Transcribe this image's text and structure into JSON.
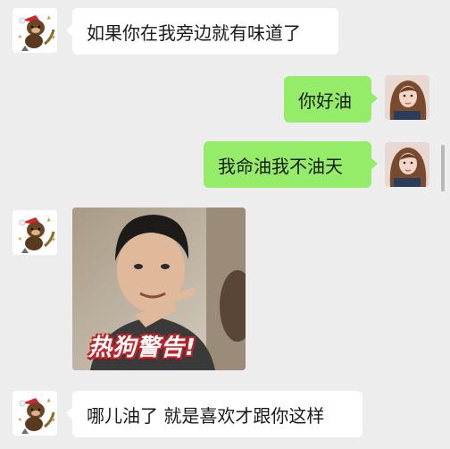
{
  "colors": {
    "background": "#ededed",
    "incoming_bubble": "#ffffff",
    "outgoing_bubble": "#95ec69"
  },
  "messages": [
    {
      "direction": "incoming",
      "type": "text",
      "text": "如果你在我旁边就有味道了",
      "avatar": "bear-sticker-avatar"
    },
    {
      "direction": "outgoing",
      "type": "text",
      "text": "你好油",
      "avatar": "girl-portrait-avatar"
    },
    {
      "direction": "outgoing",
      "type": "text",
      "text": "我命油我不油天",
      "avatar": "girl-portrait-avatar"
    },
    {
      "direction": "incoming",
      "type": "image",
      "caption": "热狗警告!",
      "avatar": "bear-sticker-avatar"
    },
    {
      "direction": "incoming",
      "type": "text",
      "text": "哪儿油了 就是喜欢才跟你这样",
      "avatar": "bear-sticker-avatar"
    }
  ]
}
